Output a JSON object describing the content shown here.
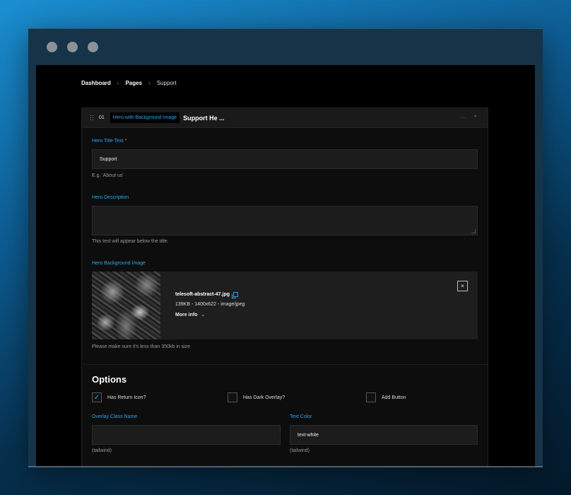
{
  "breadcrumb": [
    "Dashboard",
    "Pages",
    "Support"
  ],
  "block": {
    "number": "01",
    "type": "Hero with Background Image",
    "title": "Support He ...",
    "actions": [
      "···",
      "⌃"
    ]
  },
  "fields": {
    "hero_title": {
      "label": "Hero Title Text",
      "required_mark": "*",
      "value": "Support",
      "hint": "E.g. 'About us'"
    },
    "hero_description": {
      "label": "Hero Description",
      "value": "",
      "hint": "This text will appear below the title."
    },
    "hero_background": {
      "label": "Hero Background Image",
      "file_name": "telesoft-abstract-47.jpg",
      "file_meta": "139KB - 1400x622 - image/jpeg",
      "more_info": "More info",
      "remove": "×",
      "hint": "Please make sure it's less than 350kb in size"
    }
  },
  "options": {
    "title": "Options",
    "checkboxes": [
      {
        "label": "Has Return Icon?",
        "checked": true,
        "mark": "✓"
      },
      {
        "label": "Has Dark Overlay?",
        "checked": false,
        "mark": ""
      },
      {
        "label": "Add Button",
        "checked": false,
        "mark": ""
      }
    ],
    "overlay_class": {
      "label": "Overlay Class Name",
      "value": "",
      "hint": "(tailwind)"
    },
    "text_color": {
      "label": "Text Color",
      "value": "text-white",
      "hint": "(tailwind)"
    }
  },
  "colors": {
    "accent": "#2aa7f0",
    "background": "#000000",
    "panel": "#0d0d0d",
    "input": "#1c1c1c"
  }
}
